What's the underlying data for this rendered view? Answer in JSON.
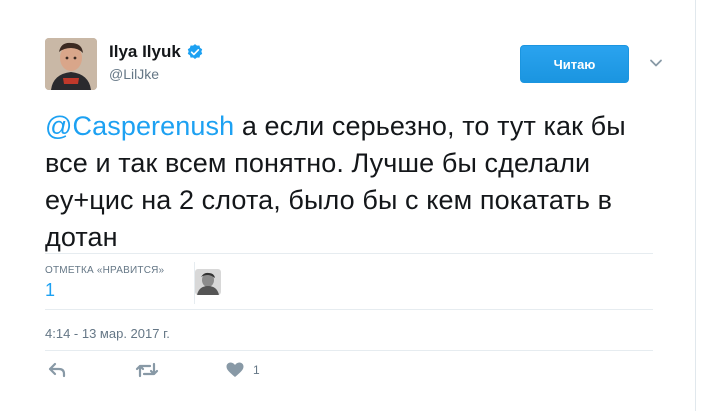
{
  "author": {
    "fullname": "Ilya Ilyuk",
    "username": "@LilJke",
    "verified": true,
    "avatar": "avatar-photo"
  },
  "follow_button": {
    "label": "Читаю",
    "color": "#1b95e0"
  },
  "tweet": {
    "mention": "@Casperenush",
    "text": " а если серьезно, то тут как бы все и так всем понятно. Лучше бы сделали еу+цис на 2 слота, было бы с кем покатать в дотан",
    "mention_color": "#1da1f2"
  },
  "stats": {
    "likes_label": "ОТМЕТКА «НРАВИТСЯ»",
    "likes_value": "1"
  },
  "timestamp": "4:14 - 13 мар. 2017 г.",
  "actions": {
    "reply_icon": "reply-icon",
    "retweet_icon": "retweet-icon",
    "like_icon": "heart-icon",
    "like_count": "1"
  }
}
